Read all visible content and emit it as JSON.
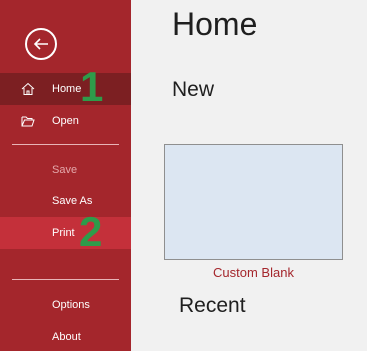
{
  "sidebar": {
    "back_label": "Back",
    "items": [
      {
        "label": "Home",
        "icon": "home-icon"
      },
      {
        "label": "Open",
        "icon": "folder-open-icon"
      },
      {
        "label": "Save"
      },
      {
        "label": "Save As"
      },
      {
        "label": "Print"
      },
      {
        "label": "Options"
      },
      {
        "label": "About"
      }
    ]
  },
  "markers": [
    "1",
    "2"
  ],
  "main": {
    "title": "Home",
    "new_heading": "New",
    "template_label": "Custom Blank",
    "recent_heading": "Recent"
  },
  "colors": {
    "sidebar": "#a4262c",
    "selected": "#7c1f22",
    "hover": "#c4303a",
    "marker": "#2e9c4a",
    "template_fill": "#dce6f2"
  }
}
